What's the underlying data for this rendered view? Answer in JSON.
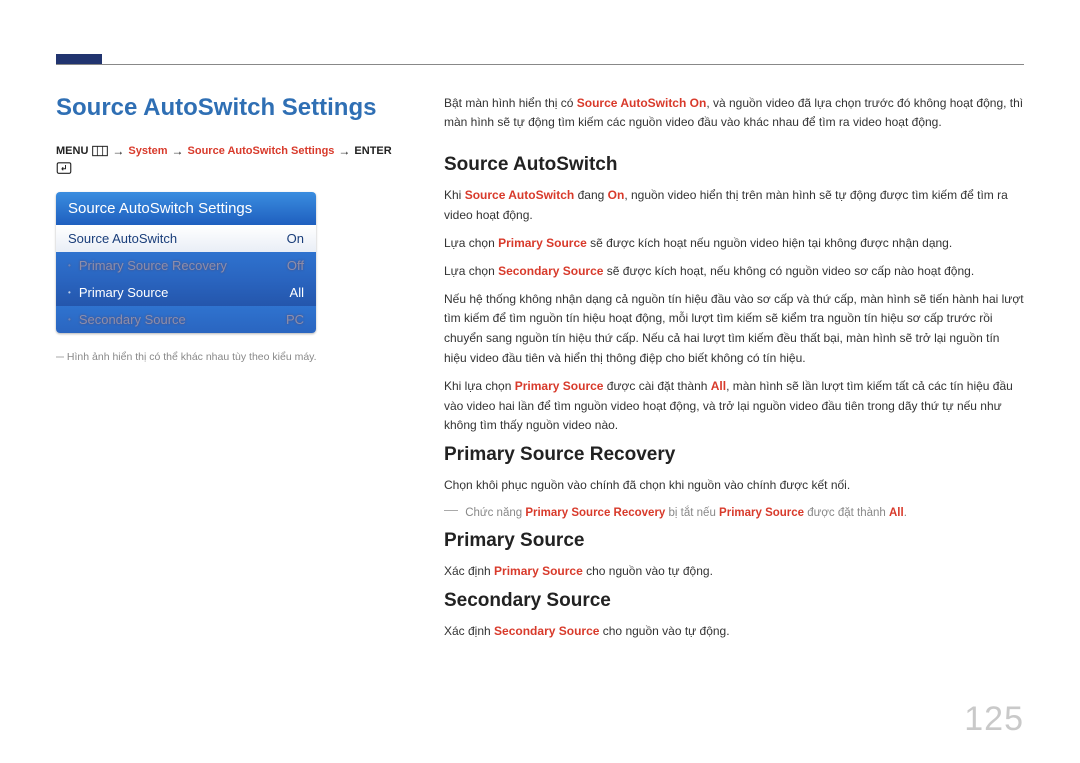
{
  "page_number": "125",
  "page_title": "Source AutoSwitch Settings",
  "breadcrumb": {
    "menu": "MENU",
    "system": "System",
    "settings": "Source AutoSwitch Settings",
    "enter": "ENTER"
  },
  "osd": {
    "title": "Source AutoSwitch Settings",
    "rows": [
      {
        "label": "Source AutoSwitch",
        "value": "On"
      },
      {
        "label": "Primary Source Recovery",
        "value": "Off"
      },
      {
        "label": "Primary Source",
        "value": "All"
      },
      {
        "label": "Secondary Source",
        "value": "PC"
      }
    ]
  },
  "caption": "Hình ảnh hiển thị có thể khác nhau tùy theo kiểu máy.",
  "intro": {
    "p1a": "Bật màn hình hiển thị có ",
    "p1b": "Source AutoSwitch On",
    "p1c": ", và nguồn video đã lựa chọn trước đó không hoạt động, thì màn hình sẽ tự động tìm kiếm các nguồn video đầu vào khác nhau để tìm ra video hoạt động."
  },
  "sections": {
    "s1": {
      "title": "Source AutoSwitch",
      "p1a": "Khi ",
      "p1b": "Source AutoSwitch",
      "p1c": " đang ",
      "p1d": "On",
      "p1e": ", nguồn video hiển thị trên màn hình sẽ tự động được tìm kiếm để tìm ra video hoạt động.",
      "p2a": "Lựa chọn ",
      "p2b": "Primary Source",
      "p2c": " sẽ được kích hoạt nếu nguồn video hiện tại không được nhận dạng.",
      "p3a": "Lựa chọn ",
      "p3b": "Secondary Source",
      "p3c": " sẽ được kích hoạt, nếu không có nguồn video sơ cấp nào hoạt động.",
      "p4": "Nếu hệ thống không nhận dạng cả nguồn tín hiệu đầu vào sơ cấp và thứ cấp, màn hình sẽ tiến hành hai lượt tìm kiếm để tìm nguồn tín hiệu hoạt động, mỗi lượt tìm kiếm sẽ kiểm tra nguồn tín hiệu sơ cấp trước rồi chuyển sang nguồn tín hiệu thứ cấp. Nếu cả hai lượt tìm kiếm đều thất bại, màn hình sẽ trở lại nguồn tín hiệu video đầu tiên và hiển thị thông điệp cho biết không có tín hiệu.",
      "p5a": "Khi lựa chọn ",
      "p5b": "Primary Source",
      "p5c": " được cài đặt thành ",
      "p5d": "All",
      "p5e": ", màn hình sẽ lần lượt tìm kiếm tất cả các tín hiệu đầu vào video hai lần để tìm nguồn video hoạt động, và trở lại nguồn video đầu tiên trong dãy thứ tự nếu như không tìm thấy nguồn video nào."
    },
    "s2": {
      "title": "Primary Source Recovery",
      "p1": "Chọn khôi phục nguồn vào chính đã chọn khi nguồn vào chính được kết nối.",
      "note_a": "Chức năng ",
      "note_b": "Primary Source Recovery",
      "note_c": " bị tắt nếu ",
      "note_d": "Primary Source",
      "note_e": " được đặt thành ",
      "note_f": "All",
      "note_g": "."
    },
    "s3": {
      "title": "Primary Source",
      "p1a": "Xác định ",
      "p1b": "Primary Source",
      "p1c": " cho nguồn vào tự động."
    },
    "s4": {
      "title": "Secondary Source",
      "p1a": "Xác định ",
      "p1b": "Secondary Source",
      "p1c": " cho nguồn vào tự động."
    }
  }
}
